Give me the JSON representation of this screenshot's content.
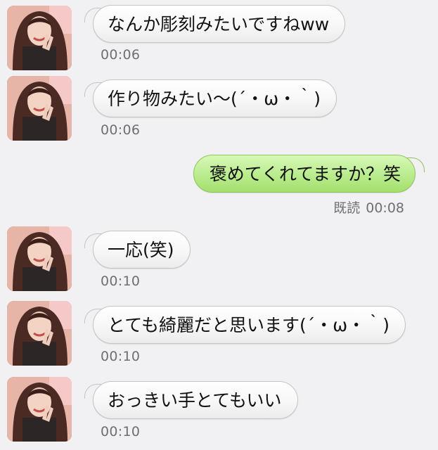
{
  "conversation": {
    "messages": [
      {
        "direction": "in",
        "text": "なんか彫刻みたいですねww",
        "time": "00:06",
        "avatar_icon": "contact-avatar"
      },
      {
        "direction": "in",
        "text": "作り物みたい〜(´・ω・｀)",
        "time": "00:06",
        "avatar_icon": "contact-avatar"
      },
      {
        "direction": "out",
        "text": "褒めてくれてますか？笑",
        "time": "00:08",
        "read_label": "既読"
      },
      {
        "direction": "in",
        "text": "一応(笑)",
        "time": "00:10",
        "avatar_icon": "contact-avatar"
      },
      {
        "direction": "in",
        "text": "とても綺麗だと思います(´・ω・｀)",
        "time": "00:10",
        "avatar_icon": "contact-avatar"
      },
      {
        "direction": "in",
        "text": "おっきい手とてもいい",
        "time": "00:10",
        "avatar_icon": "contact-avatar"
      }
    ]
  },
  "colors": {
    "background": "#f1f1f3",
    "incoming_bubble": "#f7f7f7",
    "outgoing_bubble": "#b9ec8d",
    "timestamp": "#6f6f72"
  }
}
